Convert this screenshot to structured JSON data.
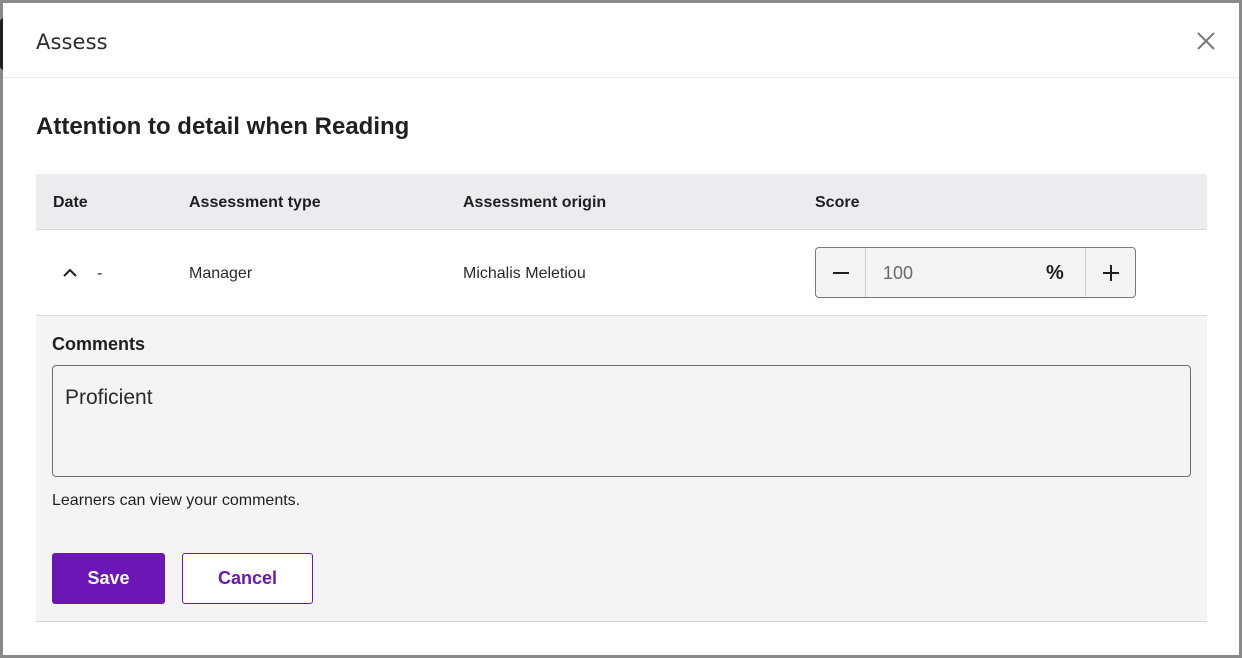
{
  "dialog": {
    "title": "Assess",
    "close_icon": "close-icon"
  },
  "skill": {
    "title": "Attention to detail when Reading"
  },
  "table": {
    "headers": [
      "Date",
      "Assessment type",
      "Assessment origin",
      "Score"
    ],
    "row": {
      "expand_icon": "chevron-up-icon",
      "date": "-",
      "type": "Manager",
      "origin": "Michalis Meletiou",
      "score": {
        "value": "100",
        "unit": "%",
        "decrement_icon": "minus-icon",
        "increment_icon": "plus-icon"
      }
    }
  },
  "comments": {
    "label": "Comments",
    "value": "Proficient",
    "hint": "Learners can view your comments."
  },
  "actions": {
    "save_label": "Save",
    "cancel_label": "Cancel"
  },
  "colors": {
    "accent": "#6c17b5",
    "header_bg": "#ececee",
    "panel_bg": "#f4f4f4"
  }
}
